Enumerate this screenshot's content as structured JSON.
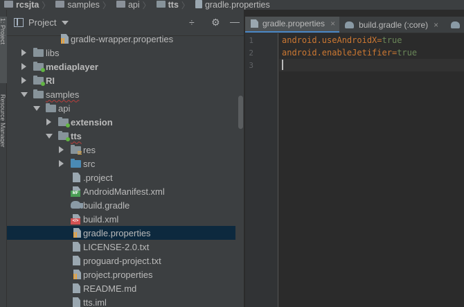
{
  "breadcrumb": {
    "items": [
      "rcsjta",
      "samples",
      "api",
      "tts",
      "gradle.properties"
    ]
  },
  "left_strip": {
    "labels": [
      "1: Project",
      "Resource Manager"
    ]
  },
  "project_panel": {
    "title": "Project",
    "tools": {
      "collapse": "÷",
      "settings": "⚙",
      "hide": "—"
    }
  },
  "tree": {
    "top_item": "gradle-wrapper.properties",
    "items": [
      {
        "label": "libs"
      },
      {
        "label": "mediaplayer"
      },
      {
        "label": "RI"
      },
      {
        "label": "samples"
      },
      {
        "label": "api"
      },
      {
        "label": "extension"
      },
      {
        "label": "tts"
      },
      {
        "label": "res"
      },
      {
        "label": "src"
      },
      {
        "label": ".project"
      },
      {
        "label": "AndroidManifest.xml"
      },
      {
        "label": "build.gradle"
      },
      {
        "label": "build.xml"
      },
      {
        "label": "gradle.properties"
      },
      {
        "label": "LICENSE-2.0.txt"
      },
      {
        "label": "proguard-project.txt"
      },
      {
        "label": "project.properties"
      },
      {
        "label": "README.md"
      },
      {
        "label": "tts.iml"
      }
    ]
  },
  "editor": {
    "tabs": [
      {
        "label": "gradle.properties",
        "close": "×"
      },
      {
        "label": "build.gradle (:core)",
        "close": "×"
      }
    ],
    "lines": [
      {
        "num": "1",
        "key": "android.useAndroidX",
        "eq": "=",
        "value": "true"
      },
      {
        "num": "2",
        "key": "android.enableJetifier",
        "eq": "=",
        "value": "true"
      },
      {
        "num": "3",
        "key": "",
        "eq": "",
        "value": ""
      }
    ]
  },
  "colors": {
    "panel_bg": "#3c3f41",
    "editor_bg": "#2b2b2b",
    "selected_row": "#0d293e",
    "keyword_orange": "#cc7832",
    "value_green": "#6a8759",
    "tab_accent": "#4a88c7"
  }
}
